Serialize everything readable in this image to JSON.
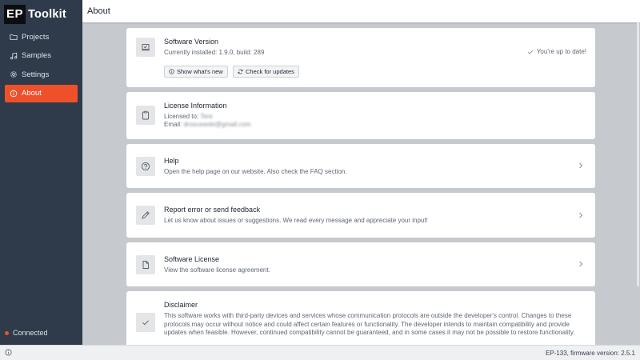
{
  "app": {
    "logo_badge": "EP",
    "logo_text": "Toolkit"
  },
  "sidebar": {
    "items": [
      {
        "label": "Projects",
        "icon": "folder-icon"
      },
      {
        "label": "Samples",
        "icon": "music-note-icon"
      },
      {
        "label": "Settings",
        "icon": "gear-icon"
      },
      {
        "label": "About",
        "icon": "info-icon",
        "active": true
      }
    ],
    "status": "Connected"
  },
  "header": {
    "title": "About"
  },
  "cards": {
    "version": {
      "title": "Software Version",
      "text": "Currently installed: 1.9.0, build: 289",
      "status": "You're up to date!",
      "btn_whats_new": "Show what's new",
      "btn_check": "Check for updates"
    },
    "license_info": {
      "title": "License Information",
      "licensed_label": "Licensed to:",
      "licensed_value": "Tere",
      "email_label": "Email:",
      "email_value": "droscewski@gmail.com"
    },
    "help": {
      "title": "Help",
      "text": "Open the help page on our website. Also check the FAQ section."
    },
    "report": {
      "title": "Report error or send feedback",
      "text": "Let us know about issues or suggestions. We read every message and appreciate your input!"
    },
    "license": {
      "title": "Software License",
      "text": "View the software license agreement."
    },
    "disclaimer": {
      "title": "Disclaimer",
      "text": "This software works with third-party devices and services whose communication protocols are outside the developer's control. Changes to these protocols may occur without notice and could affect certain features or functionality. The developer intends to maintain compatibility and provide updates when feasible. However, continued compatibility cannot be guaranteed, and in some cases it may not be possible to restore functionality."
    }
  },
  "footer": {
    "device": "EP-133, firmware version: 2.5.1"
  },
  "colors": {
    "accent": "#ee5129",
    "sidebar": "#2f3b4b",
    "background": "#c6c9cd"
  }
}
